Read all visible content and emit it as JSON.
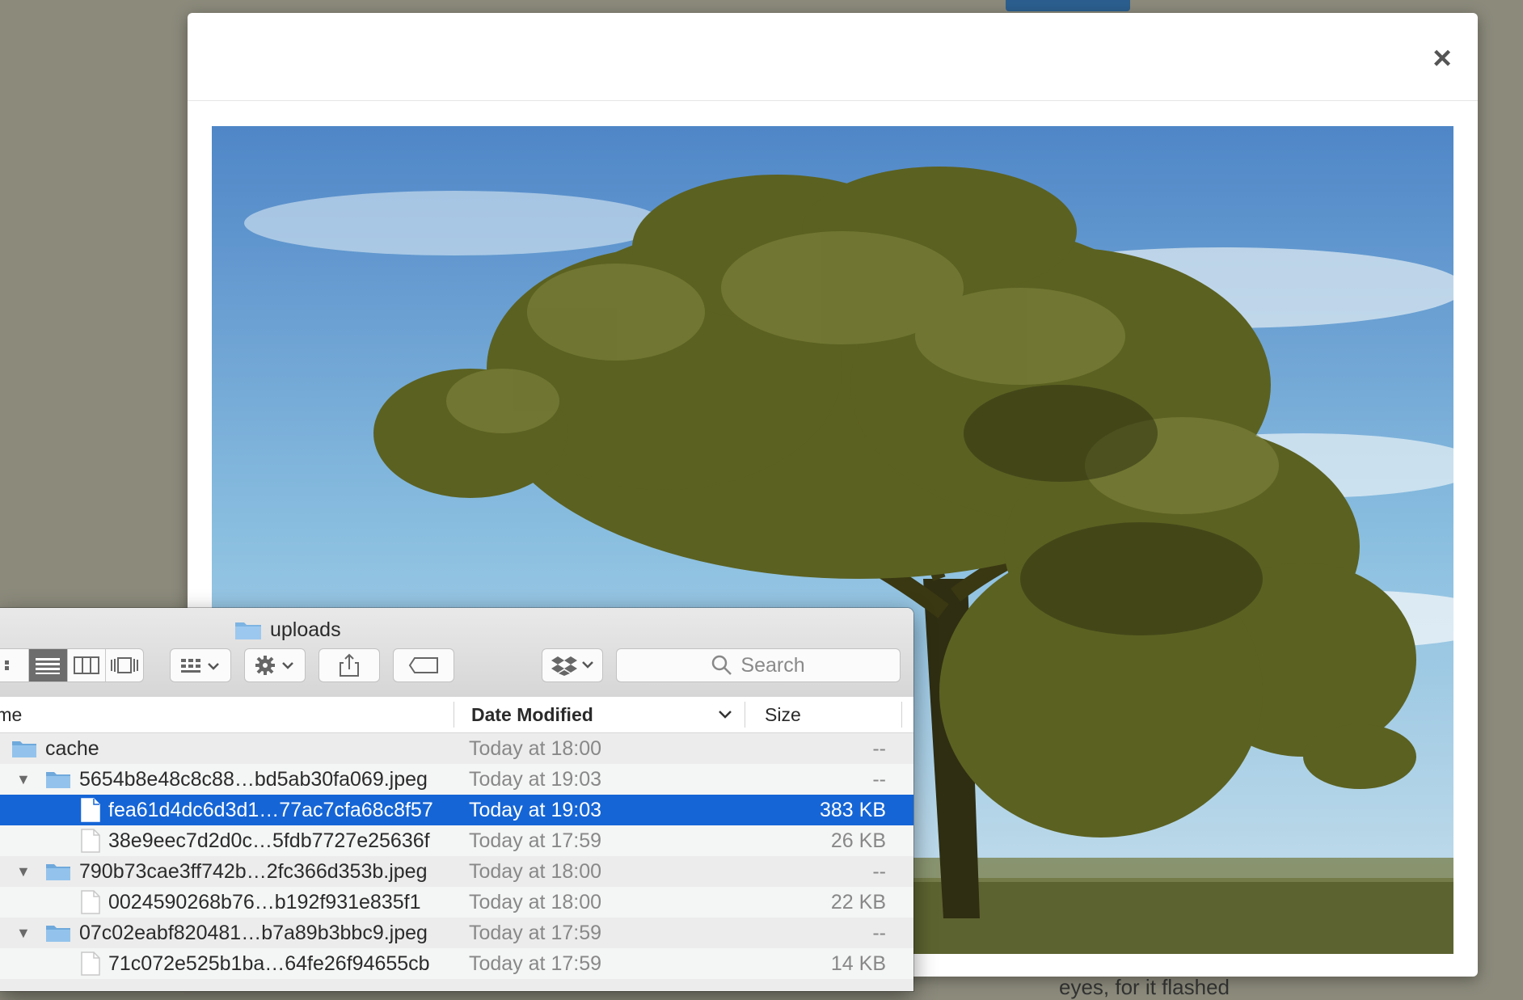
{
  "modal": {
    "close_label": "×"
  },
  "background": {
    "partial_text": "eyes, for it flashed"
  },
  "finder": {
    "title": "uploads",
    "search_placeholder": "Search",
    "columns": {
      "name": "Name",
      "date": "Date Modified",
      "size": "Size"
    },
    "rows": [
      {
        "name": "cache",
        "date": "Today at 18:00",
        "size": "--",
        "kind": "folder",
        "level": 0,
        "expanded": false
      },
      {
        "name": "5654b8e48c8c88…bd5ab30fa069.jpeg",
        "date": "Today at 19:03",
        "size": "--",
        "kind": "folder",
        "level": 0,
        "expanded": true
      },
      {
        "name": "fea61d4dc6d3d1…77ac7cfa68c8f57",
        "date": "Today at 19:03",
        "size": "383 KB",
        "kind": "file",
        "level": 1,
        "selected": true
      },
      {
        "name": "38e9eec7d2d0c…5fdb7727e25636f",
        "date": "Today at 17:59",
        "size": "26 KB",
        "kind": "file",
        "level": 1
      },
      {
        "name": "790b73cae3ff742b…2fc366d353b.jpeg",
        "date": "Today at 18:00",
        "size": "--",
        "kind": "folder",
        "level": 0,
        "expanded": true
      },
      {
        "name": "0024590268b76…b192f931e835f1",
        "date": "Today at 18:00",
        "size": "22 KB",
        "kind": "file",
        "level": 1
      },
      {
        "name": "07c02eabf820481…b7a89b3bbc9.jpeg",
        "date": "Today at 17:59",
        "size": "--",
        "kind": "folder",
        "level": 0,
        "expanded": true
      },
      {
        "name": "71c072e525b1ba…64fe26f94655cb",
        "date": "Today at 17:59",
        "size": "14 KB",
        "kind": "file",
        "level": 1
      }
    ]
  },
  "colors": {
    "selection": "#1565d6",
    "backdrop": "#8b8a7b",
    "foliage": "#5b6121"
  },
  "icons": [
    "close-icon",
    "folder-icon",
    "file-icon",
    "list-view-icon",
    "column-view-icon",
    "coverflow-view-icon",
    "group-icon",
    "gear-icon",
    "share-icon",
    "tag-icon",
    "dropbox-icon",
    "search-icon",
    "disclosure-triangle-icon"
  ]
}
